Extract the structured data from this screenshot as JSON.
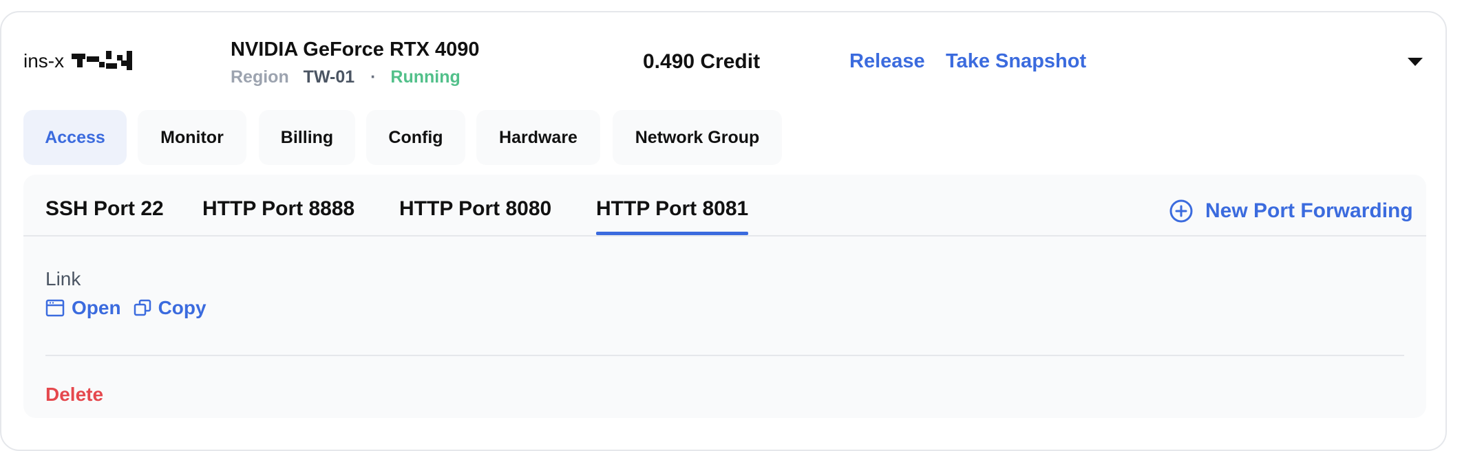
{
  "instance": {
    "name_prefix": "ins-x",
    "gpu": "NVIDIA GeForce RTX 4090",
    "region_label": "Region",
    "region_value": "TW-01",
    "separator": "·",
    "status": "Running",
    "credit": "0.490 Credit",
    "release_label": "Release",
    "snapshot_label": "Take Snapshot"
  },
  "tabs": [
    {
      "label": "Access",
      "active": true
    },
    {
      "label": "Monitor"
    },
    {
      "label": "Billing"
    },
    {
      "label": "Config"
    },
    {
      "label": "Hardware"
    },
    {
      "label": "Network Group"
    }
  ],
  "ports": [
    {
      "label": "SSH Port 22"
    },
    {
      "label": "HTTP Port 8888"
    },
    {
      "label": "HTTP Port 8080"
    },
    {
      "label": "HTTP Port 8081",
      "active": true
    }
  ],
  "new_port_label": "New Port Forwarding",
  "link": {
    "label": "Link",
    "open_label": "Open",
    "copy_label": "Copy"
  },
  "delete_label": "Delete",
  "colors": {
    "accent": "#3b6bde",
    "running": "#52c08a",
    "danger": "#e5484d"
  }
}
